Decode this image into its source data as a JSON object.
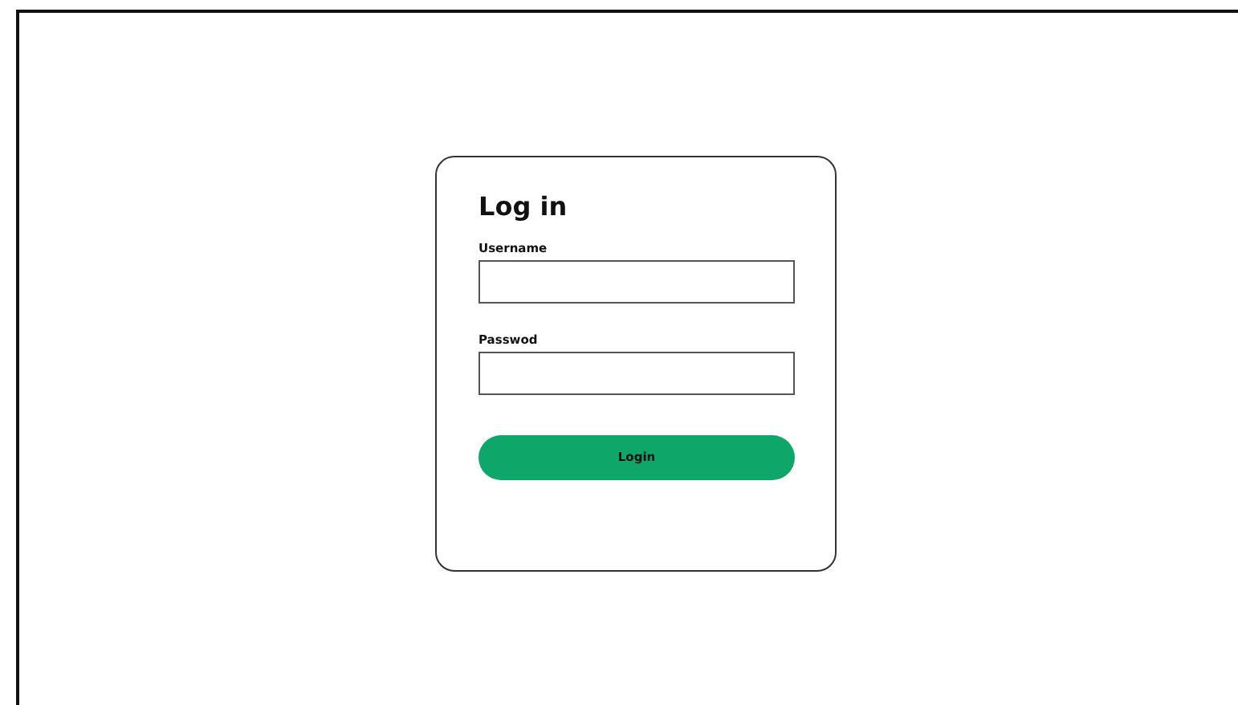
{
  "form": {
    "title": "Log in",
    "fields": [
      {
        "label": "Username"
      },
      {
        "label": "Passwod"
      }
    ],
    "submit": {
      "label": "Login"
    }
  }
}
